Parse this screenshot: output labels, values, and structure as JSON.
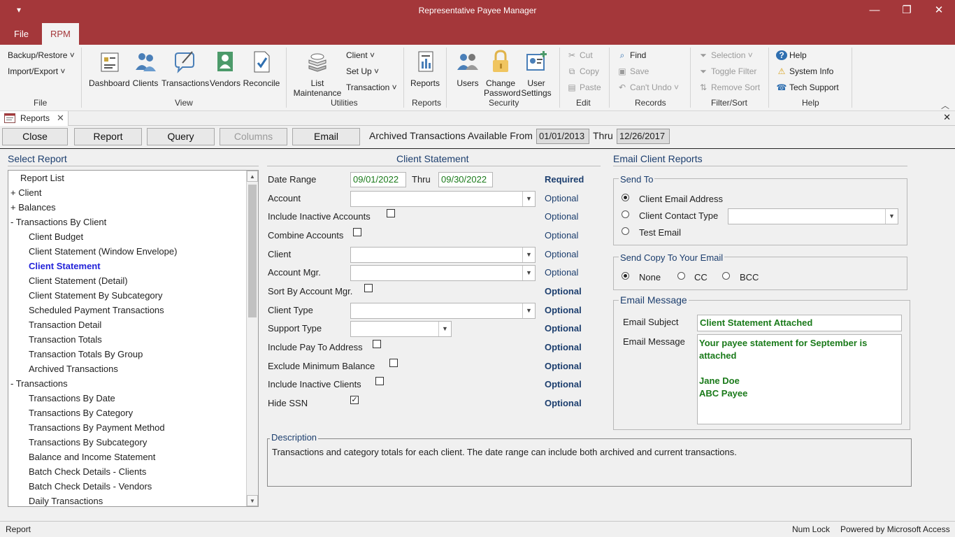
{
  "window": {
    "title": "Representative Payee Manager",
    "qa_icon": "▾",
    "minimize": "—",
    "restore": "❐",
    "close": "✕"
  },
  "ribbon_tabs": [
    "File",
    "RPM"
  ],
  "ribbon": {
    "file_group": {
      "items": [
        "Backup/Restore",
        "Import/Export"
      ],
      "label": "File"
    },
    "view_group": {
      "items": [
        "Dashboard",
        "Clients",
        "Transactions",
        "Vendors",
        "Reconcile"
      ],
      "label": "View"
    },
    "utilities_group": {
      "big": [
        "List",
        "Maintenance"
      ],
      "items": [
        "Client",
        "Set Up",
        "Transaction"
      ],
      "label": "Utilities"
    },
    "reports_group": {
      "big": "Reports",
      "label": "Reports"
    },
    "security_group": {
      "items": [
        "Users",
        "Change",
        "Password",
        "User",
        "Settings"
      ],
      "label": "Security"
    },
    "edit_group": {
      "items": [
        "Cut",
        "Copy",
        "Paste"
      ],
      "label": "Edit"
    },
    "records_group": {
      "items": [
        "Find",
        "Save",
        "Can't Undo"
      ],
      "label": "Records"
    },
    "filter_group": {
      "items": [
        "Selection",
        "Toggle Filter",
        "Remove Sort"
      ],
      "label": "Filter/Sort"
    },
    "help_group": {
      "items": [
        "Help",
        "System Info",
        "Tech Support"
      ],
      "label": "Help"
    },
    "collapse": "︿"
  },
  "doc_tab": {
    "label": "Reports",
    "close": "✕",
    "pane_close": "✕"
  },
  "toolbar": {
    "close": "Close",
    "report": "Report",
    "query": "Query",
    "columns": "Columns",
    "email": "Email",
    "archived_label": "Archived Transactions Available From",
    "from_date": "01/01/2013",
    "thru_label": "Thru",
    "thru_date": "12/26/2017"
  },
  "select_report": {
    "title": "Select Report",
    "items": [
      {
        "text": "Report List",
        "indent": 0
      },
      {
        "text": "+  Client",
        "indent": 0
      },
      {
        "text": "+  Balances",
        "indent": 0
      },
      {
        "text": "-   Transactions By Client",
        "indent": 0
      },
      {
        "text": "Client Budget",
        "indent": 1
      },
      {
        "text": "Client Statement (Window Envelope)",
        "indent": 1
      },
      {
        "text": "Client Statement",
        "indent": 1,
        "selected": true
      },
      {
        "text": "Client Statement (Detail)",
        "indent": 1
      },
      {
        "text": "Client Statement By Subcategory",
        "indent": 1
      },
      {
        "text": "Scheduled Payment Transactions",
        "indent": 1
      },
      {
        "text": "Transaction Detail",
        "indent": 1
      },
      {
        "text": "Transaction Totals",
        "indent": 1
      },
      {
        "text": "Transaction Totals By Group",
        "indent": 1
      },
      {
        "text": "Archived Transactions",
        "indent": 1
      },
      {
        "text": "-   Transactions",
        "indent": 0
      },
      {
        "text": "Transactions By Date",
        "indent": 1
      },
      {
        "text": "Transactions By Category",
        "indent": 1
      },
      {
        "text": "Transactions By Payment Method",
        "indent": 1
      },
      {
        "text": "Transactions By Subcategory",
        "indent": 1
      },
      {
        "text": "Balance and Income Statement",
        "indent": 1
      },
      {
        "text": "Batch Check Details - Clients",
        "indent": 1
      },
      {
        "text": "Batch Check Details - Vendors",
        "indent": 1
      },
      {
        "text": "Daily Transactions",
        "indent": 1
      }
    ]
  },
  "client_statement": {
    "title": "Client Statement",
    "date_range_label": "Date Range",
    "date_from": "09/01/2022",
    "thru_label": "Thru",
    "date_thru": "09/30/2022",
    "required": "Required",
    "optional": "Optional",
    "fields": {
      "account": "Account",
      "include_inactive_accounts": "Include Inactive Accounts",
      "combine_accounts": "Combine Accounts",
      "client": "Client",
      "account_mgr": "Account Mgr.",
      "sort_by_account_mgr": "Sort By Account Mgr.",
      "client_type": "Client Type",
      "support_type": "Support Type",
      "include_pay_to_address": "Include Pay To Address",
      "exclude_minimum_balance": "Exclude Minimum Balance",
      "include_inactive_clients": "Include Inactive Clients",
      "hide_ssn": "Hide SSN"
    },
    "hide_ssn_checked": "✓"
  },
  "description": {
    "title": "Description",
    "text": "Transactions and category totals for each client. The date range can include both archived and current transactions."
  },
  "email_reports": {
    "title": "Email Client Reports",
    "send_to": {
      "title": "Send To",
      "options": [
        "Client Email Address",
        "Client Contact Type",
        "Test Email"
      ],
      "selected": "Client Email Address"
    },
    "send_copy": {
      "title": "Send Copy To Your Email",
      "options": [
        "None",
        "CC",
        "BCC"
      ],
      "selected": "None"
    },
    "message": {
      "title": "Email Message",
      "subject_label": "Email Subject",
      "subject": "Client Statement Attached",
      "message_label": "Email Message",
      "body_line1": "Your payee statement for September is",
      "body_line2": "attached",
      "body_line3": "Jane Doe",
      "body_line4": "ABC Payee"
    }
  },
  "status": {
    "left": "Report",
    "num_lock": "Num Lock",
    "powered": "Powered by Microsoft Access"
  }
}
